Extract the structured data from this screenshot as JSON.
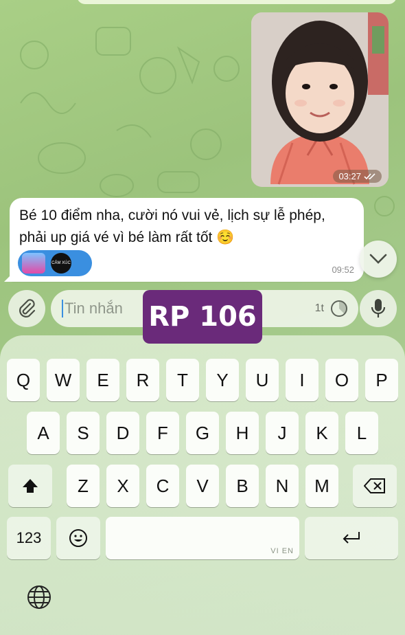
{
  "photo_message": {
    "time": "03:27"
  },
  "text_message": {
    "line1": "Bé 10 điểm nha, cười nó vui vẻ, lịch sự lễ phép,",
    "line2": "phải up giá vé vì bé làm rất tốt ☺️",
    "reaction_label": "CẢM XÚC",
    "time": "09:52"
  },
  "input": {
    "placeholder": "Tin nhắn",
    "timer": "1t"
  },
  "overlay_badge": "RP 106",
  "keyboard": {
    "row1": [
      "Q",
      "W",
      "E",
      "R",
      "T",
      "Y",
      "U",
      "I",
      "O",
      "P"
    ],
    "row2": [
      "A",
      "S",
      "D",
      "F",
      "G",
      "H",
      "J",
      "K",
      "L"
    ],
    "row3": [
      "Z",
      "X",
      "C",
      "V",
      "B",
      "N",
      "M"
    ],
    "numbers_key": "123",
    "space_lang": "VI EN"
  }
}
